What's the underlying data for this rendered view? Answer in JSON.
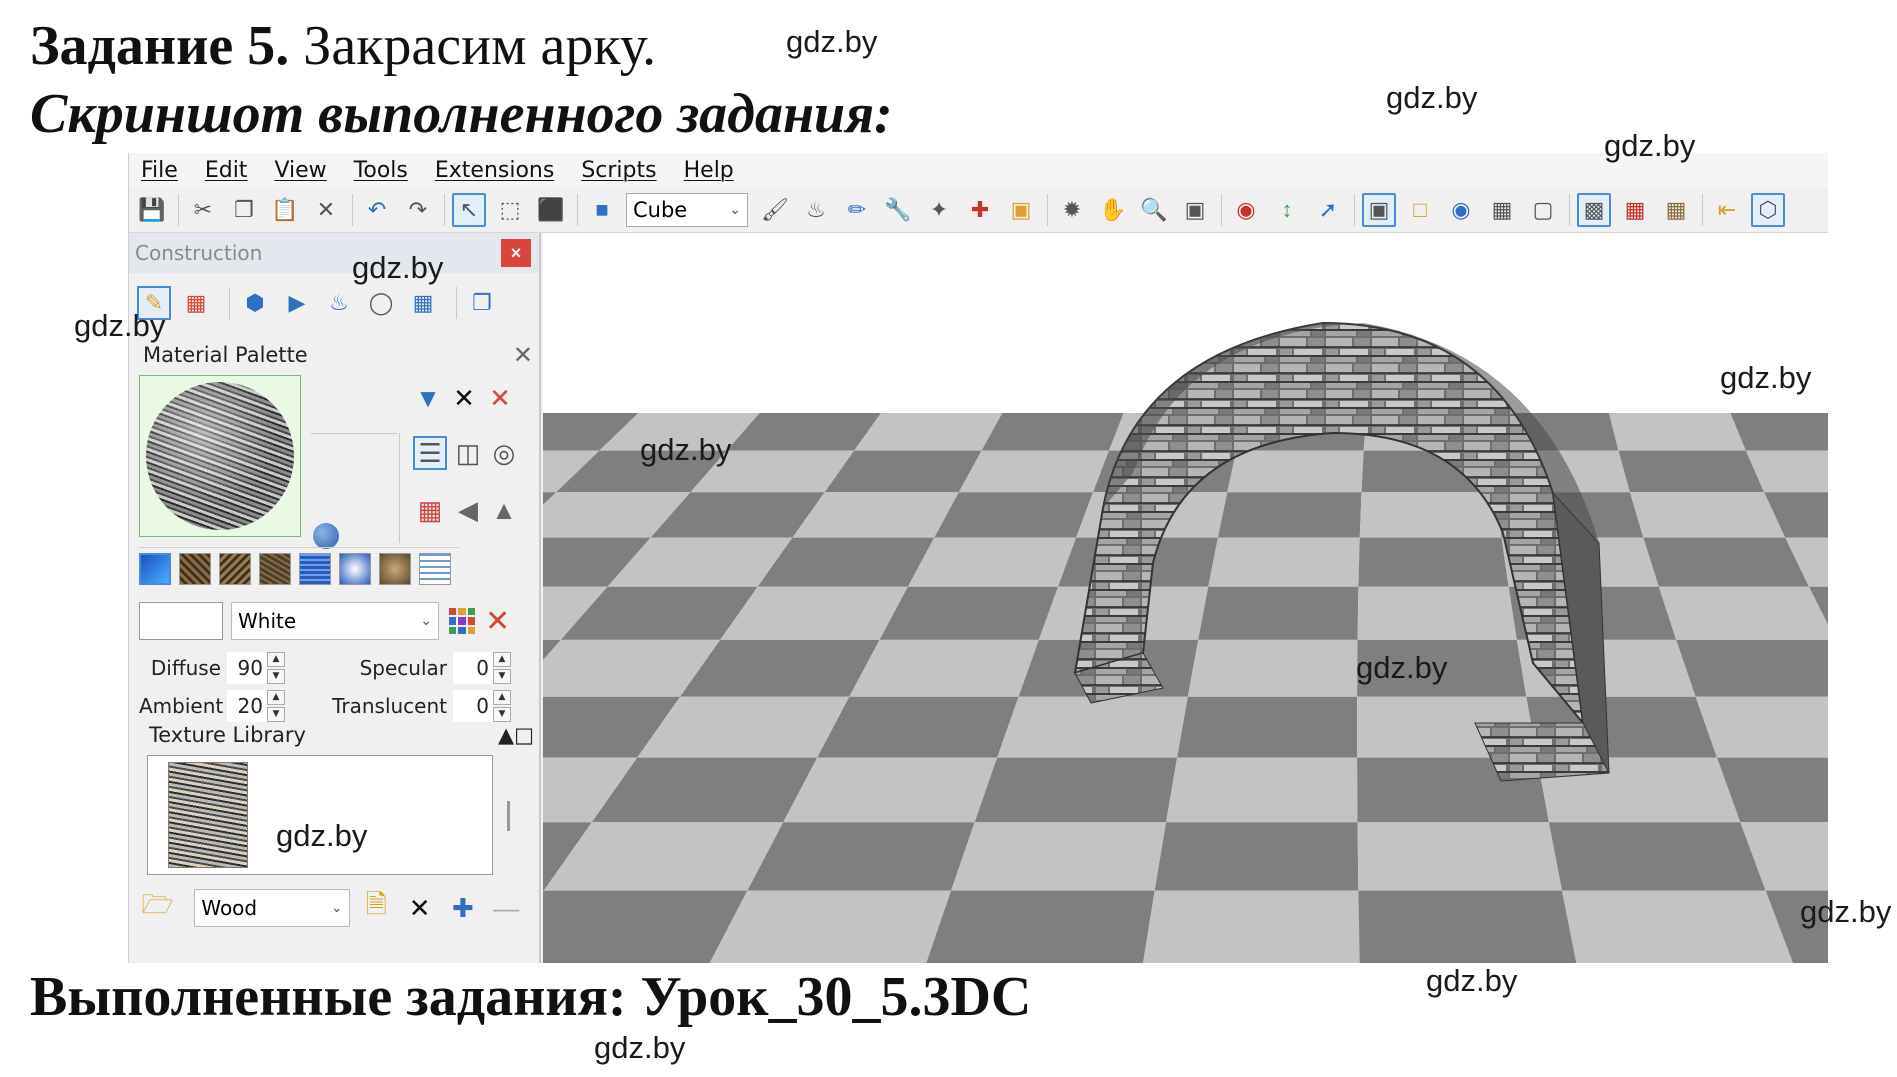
{
  "document": {
    "task_bold": "Задание 5.",
    "task_rest": "Закрасим арку.",
    "subtitle": "Скриншот выполненного задания:",
    "footer": "Выполненные задания: Урок_30_5.3DC",
    "watermark": "gdz.by"
  },
  "menu": [
    "File",
    "Edit",
    "View",
    "Tools",
    "Extensions",
    "Scripts",
    "Help"
  ],
  "toolbar": {
    "shape_select": "Cube",
    "icons": [
      "save-icon",
      "cut-icon",
      "copy-icon",
      "paste-icon",
      "delete-icon",
      "undo-icon",
      "redo-icon",
      "select-arrow-icon",
      "select-transform-icon",
      "select-group-icon",
      "cube-icon",
      "paint-icon",
      "fill-icon",
      "eyedropper-icon",
      "wrench-icon",
      "magic-wand-icon",
      "axes-icon",
      "texture-icon",
      "orbit-icon",
      "hand-icon",
      "zoom-icon",
      "fit-icon",
      "eye-icon",
      "arrow-vertical-icon",
      "arrow-diagonal-icon",
      "view-front-icon",
      "view-box-icon",
      "view-sphere-icon",
      "view-wire-icon",
      "view-frame-icon",
      "view-select-icon",
      "render-color-icon",
      "render-texture-icon",
      "import-icon",
      "perspective-icon"
    ]
  },
  "panel": {
    "title": "Construction",
    "close": "×",
    "material_palette": {
      "title": "Material Palette",
      "close": "✕",
      "color_name": "White",
      "diffuse_label": "Diffuse",
      "diffuse_value": "90",
      "ambient_label": "Ambient",
      "ambient_value": "20",
      "specular_label": "Specular",
      "specular_value": "0",
      "translucent_label": "Translucent",
      "translucent_value": "0"
    },
    "texture_library": {
      "title": "Texture Library",
      "library_select": "Wood"
    }
  },
  "colors": {
    "accent": "#4c8ad6",
    "close_red": "#d9453b",
    "floor_dark": "#7f7f7f",
    "floor_light": "#c3c3c3",
    "stone_dark": "#3a3a3a",
    "stone_light": "#b5b5b5"
  }
}
